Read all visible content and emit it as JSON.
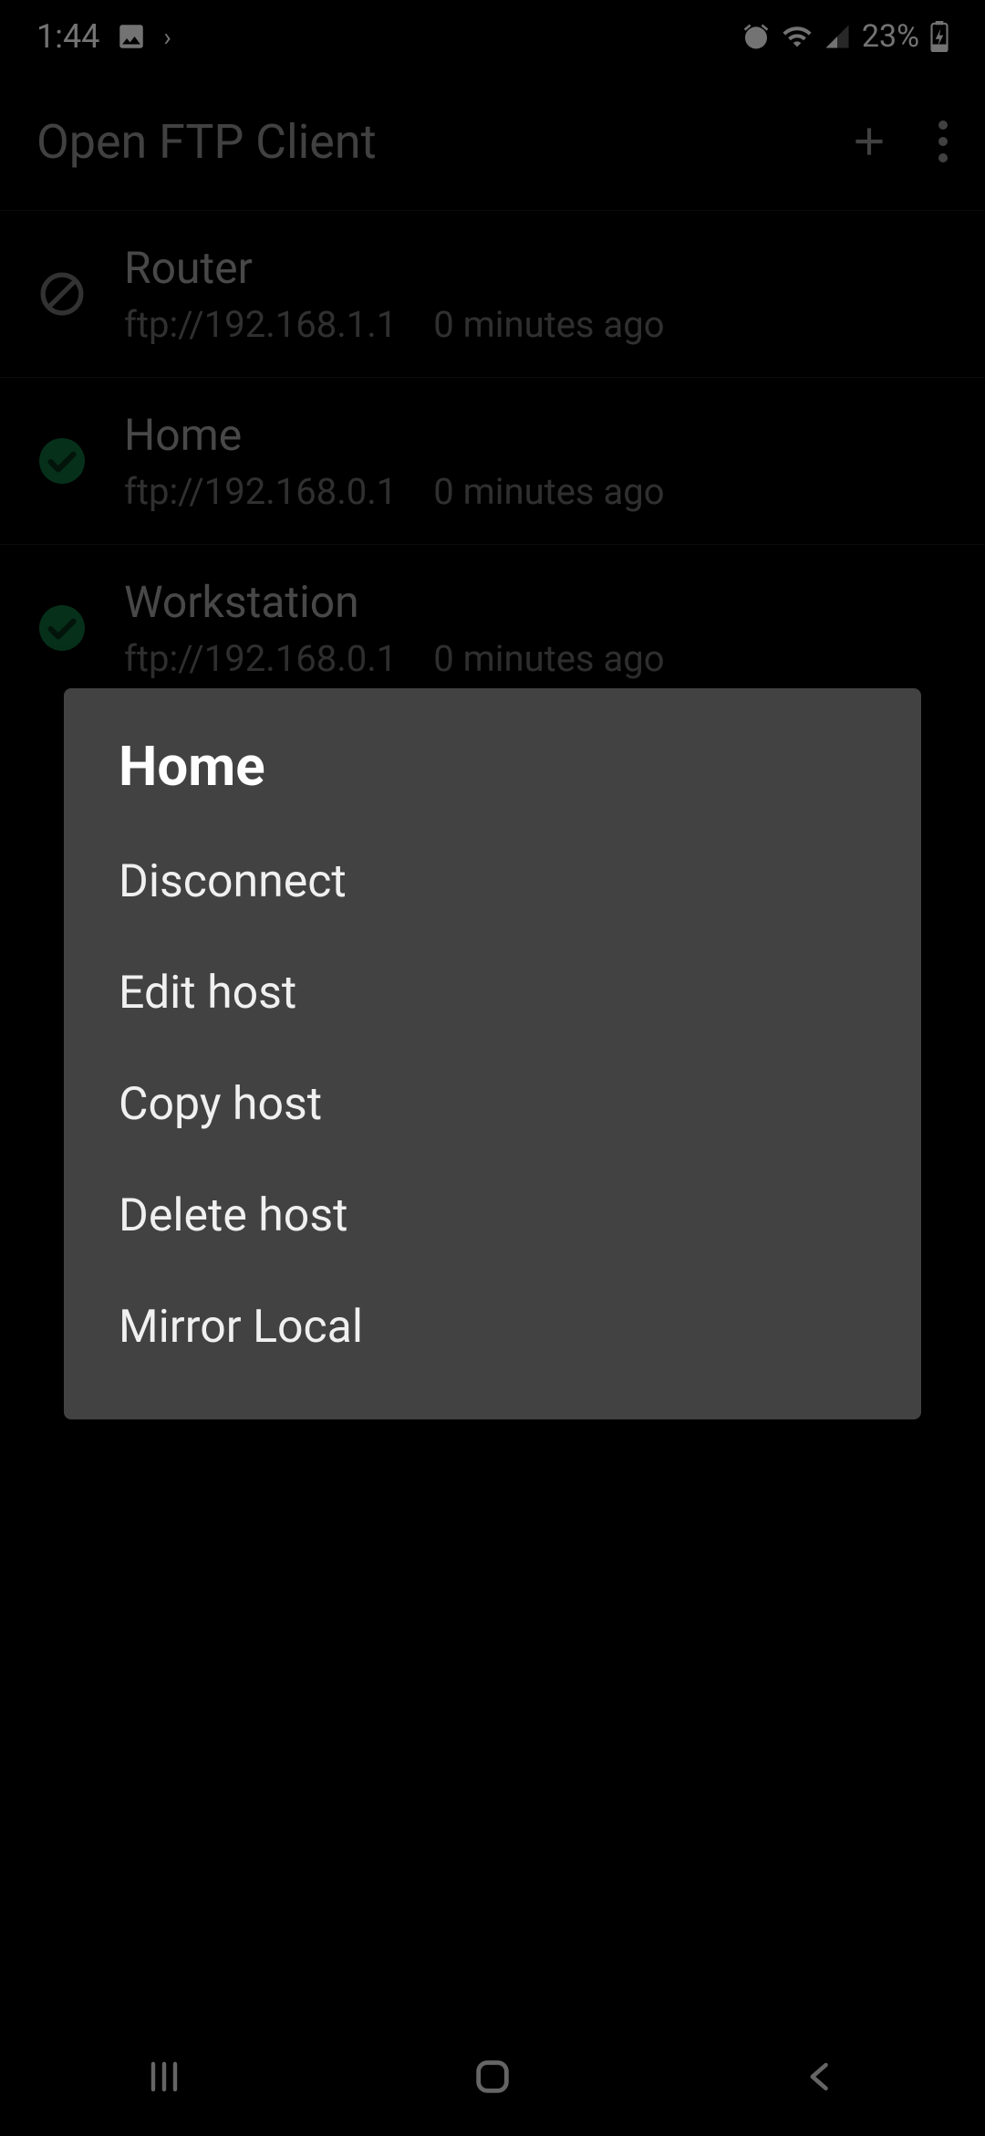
{
  "status": {
    "time": "1:44",
    "battery": "23%"
  },
  "appbar": {
    "title": "Open FTP Client"
  },
  "hosts": [
    {
      "name": "Router",
      "url": "ftp://192.168.1.1",
      "ago": "0 minutes ago",
      "status": "blocked"
    },
    {
      "name": "Home",
      "url": "ftp://192.168.0.1",
      "ago": "0 minutes ago",
      "status": "ok"
    },
    {
      "name": "Workstation",
      "url": "ftp://192.168.0.1",
      "ago": "0 minutes ago",
      "status": "ok"
    }
  ],
  "dialog": {
    "title": "Home",
    "items": [
      "Disconnect",
      "Edit host",
      "Copy host",
      "Delete host",
      "Mirror Local"
    ]
  }
}
